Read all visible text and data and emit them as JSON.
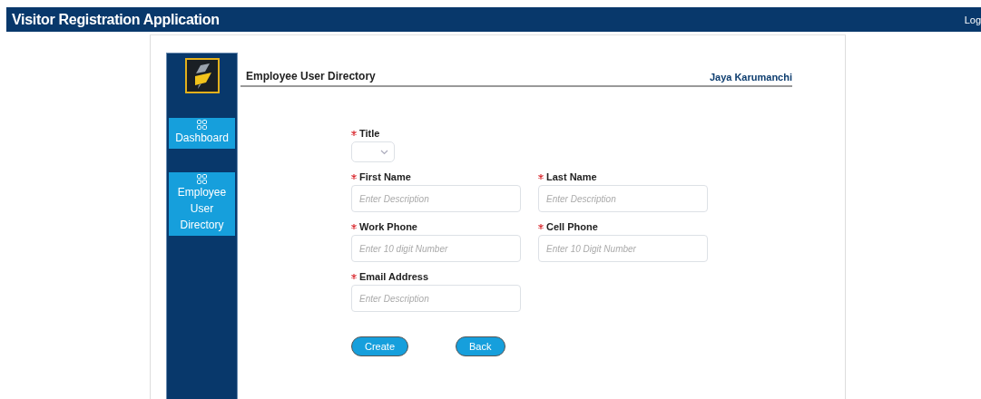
{
  "header": {
    "title": "Visitor Registration Application",
    "link": "Log"
  },
  "sidebar": {
    "items": [
      {
        "label": "Dashboard",
        "selected": false
      },
      {
        "label": "Employee User Directory",
        "selected": false
      }
    ]
  },
  "page": {
    "title": "Employee User Directory",
    "user": "Jaya Karumanchi"
  },
  "form": {
    "rows": [
      [
        {
          "kind": "select",
          "label": "Title",
          "required": true
        }
      ],
      [
        {
          "kind": "text",
          "label": "First Name",
          "required": true,
          "placeholder": "Enter Description"
        },
        {
          "kind": "text",
          "label": "Last Name",
          "required": true,
          "placeholder": "Enter Description"
        }
      ],
      [
        {
          "kind": "text",
          "label": "Work Phone",
          "required": true,
          "placeholder": "Enter 10 digit Number"
        },
        {
          "kind": "text",
          "label": "Cell Phone",
          "required": true,
          "placeholder": "Enter 10 Digit Number"
        }
      ],
      [
        {
          "kind": "text",
          "label": "Email Address",
          "required": true,
          "placeholder": "Enter Description"
        }
      ]
    ],
    "buttons": [
      "Create",
      "Back"
    ]
  }
}
